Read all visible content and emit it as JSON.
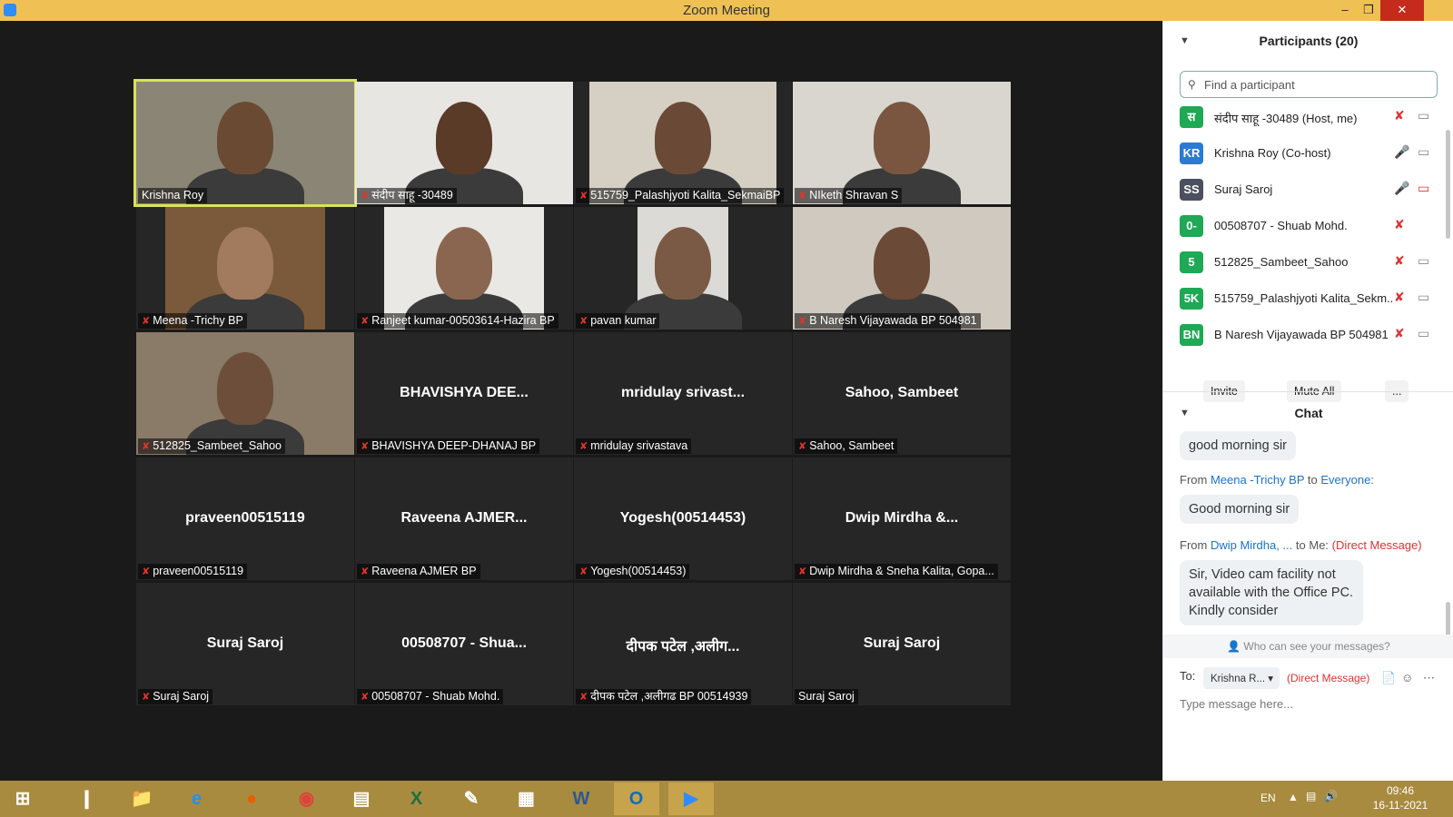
{
  "window": {
    "title": "Zoom Meeting",
    "min": "–",
    "max": "❐",
    "close": "✕"
  },
  "tiles": [
    {
      "name": "Krishna Roy",
      "muted": false,
      "video": true,
      "active": true,
      "bg": "#8b8576",
      "skin": "#6b4a34"
    },
    {
      "name": "संदीप साहू -30489",
      "muted": true,
      "video": true,
      "bg": "#e8e6e2",
      "skin": "#5a3b28"
    },
    {
      "name": "515759_Palashjyoti Kalita_SekmaiBP",
      "muted": true,
      "video": true,
      "bg": "#d6d0c4",
      "skin": "#6a4a36"
    },
    {
      "name": "NIketh Shravan S",
      "muted": true,
      "video": true,
      "bg": "#d9d6d0",
      "skin": "#7a5540"
    },
    {
      "name": "Meena -Trichy BP",
      "muted": true,
      "video": true,
      "bg": "#7a5a3a",
      "skin": "#a27a5e"
    },
    {
      "name": "Ranjeet kumar-00503614-Hazira BP",
      "muted": true,
      "video": true,
      "bg": "#eae8e4",
      "skin": "#8a6650"
    },
    {
      "name": "pavan kumar",
      "muted": true,
      "video": true,
      "bg": "#dcdad6",
      "skin": "#7a5a44"
    },
    {
      "name": "B Naresh Vijayawada BP 504981",
      "muted": true,
      "video": true,
      "bg": "#cfc9bf",
      "skin": "#6b4a38"
    },
    {
      "name": "512825_Sambeet_Sahoo",
      "muted": true,
      "video": true,
      "bg": "#8a7a68",
      "skin": "#6d4e3a"
    },
    {
      "name": "BHAVISHYA DEEP-DHANAJ BP",
      "display": "BHAVISHYA  DEE...",
      "muted": true,
      "video": false
    },
    {
      "name": "mridulay srivastava",
      "display": "mridulay srivast...",
      "muted": true,
      "video": false
    },
    {
      "name": "Sahoo, Sambeet",
      "display": "Sahoo, Sambeet",
      "muted": true,
      "video": false
    },
    {
      "name": "praveen00515119",
      "display": "praveen00515119",
      "muted": true,
      "video": false
    },
    {
      "name": "Raveena AJMER BP",
      "display": "Raveena  AJMER...",
      "muted": true,
      "video": false
    },
    {
      "name": "Yogesh(00514453)",
      "display": "Yogesh(00514453)",
      "muted": true,
      "video": false
    },
    {
      "name": "Dwip Mirdha & Sneha Kalita, Gopa...",
      "display": "Dwip Mirdha &...",
      "muted": true,
      "video": false
    },
    {
      "name": "Suraj Saroj",
      "display": "Suraj Saroj",
      "muted": true,
      "video": false
    },
    {
      "name": "00508707 - Shuab Mohd.",
      "display": "00508707 - Shua...",
      "muted": true,
      "video": false
    },
    {
      "name": "दीपक पटेल ,अलीगढ BP 00514939",
      "display": "दीपक पटेल ,अलीग...",
      "muted": true,
      "video": false
    },
    {
      "name": "Suraj Saroj",
      "display": "Suraj Saroj",
      "muted": false,
      "video": false
    }
  ],
  "participants": {
    "title": "Participants (20)",
    "search_placeholder": "Find a participant",
    "list": [
      {
        "initials": "स",
        "color": "#1fa855",
        "name": "संदीप साहू -30489 (Host, me)",
        "mic": "muted",
        "cam": "on"
      },
      {
        "initials": "KR",
        "color": "#2a7bd1",
        "name": "Krishna Roy (Co-host)",
        "mic": "on",
        "cam": "on"
      },
      {
        "initials": "SS",
        "color": "#4a5060",
        "name": "Suraj Saroj",
        "mic": "on",
        "cam": "off"
      },
      {
        "initials": "0-",
        "color": "#1fa855",
        "name": "00508707 - Shuab Mohd.",
        "mic": "muted",
        "cam": "none"
      },
      {
        "initials": "5",
        "color": "#1fa855",
        "name": "512825_Sambeet_Sahoo",
        "mic": "muted",
        "cam": "on"
      },
      {
        "initials": "5K",
        "color": "#1fa855",
        "name": "515759_Palashjyoti Kalita_Sekm...",
        "mic": "muted",
        "cam": "on"
      },
      {
        "initials": "BN",
        "color": "#1fa855",
        "name": "B Naresh Vijayawada BP 504981",
        "mic": "muted",
        "cam": "on"
      }
    ],
    "invite": "Invite",
    "mute_all": "Mute All",
    "more": "..."
  },
  "chat": {
    "title": "Chat",
    "msg1": "good morning sir",
    "from2_prefix": "From",
    "from2_sender": "Meena -Trichy BP",
    "from2_to": "to",
    "from2_target": "Everyone:",
    "msg2": "Good morning sir",
    "from3_prefix": "From",
    "from3_sender": "Dwip Mirdha, ...",
    "from3_to": "to Me:",
    "from3_flag": "(Direct Message)",
    "msg3": "Sir, Video cam facility not available with the Office PC. Kindly consider",
    "who": "Who can see your messages?",
    "to_label": "To:",
    "to_value": "Krishna R...",
    "to_flag": "(Direct Message)",
    "placeholder": "Type message here..."
  },
  "taskbar": {
    "icons": [
      "windows-icon",
      "powershell-icon",
      "file-explorer-icon",
      "internet-explorer-icon",
      "firefox-icon",
      "chrome-icon",
      "sticky-notes-icon",
      "excel-icon",
      "paint-icon",
      "calculator-icon",
      "word-icon",
      "outlook-icon",
      "zoom-icon"
    ],
    "lang": "EN",
    "time": "09:46",
    "date": "16-11-2021"
  }
}
